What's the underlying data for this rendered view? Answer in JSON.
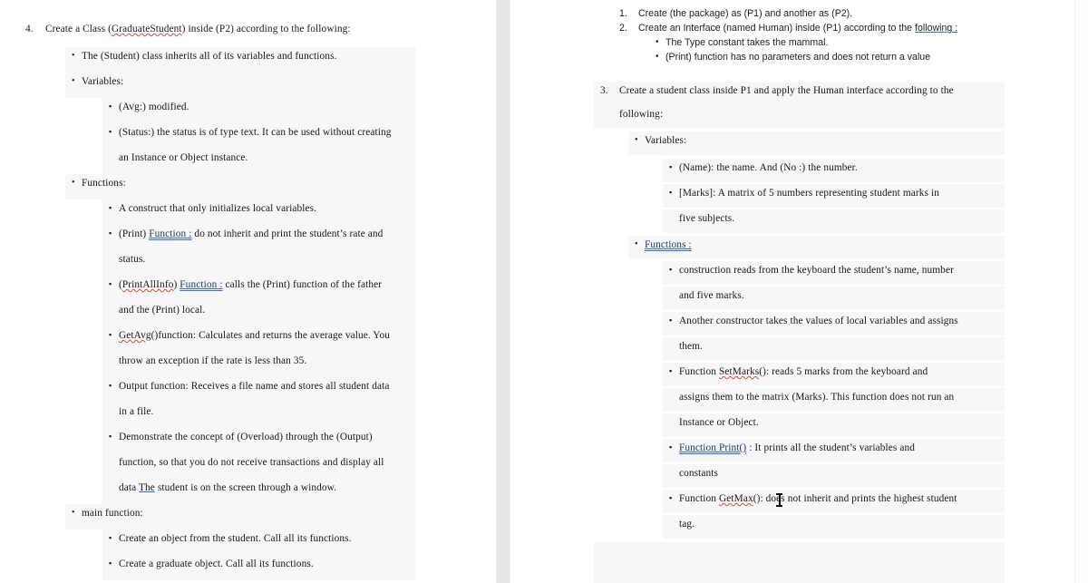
{
  "document": {
    "view": "two-page-side-by-side",
    "cursor": {
      "type": "text-ibeam",
      "over_text": "GetMax()"
    }
  },
  "left_page": {
    "items": [
      {
        "id": "l1",
        "level": "number",
        "marker": "4.",
        "text": "Create a Class (GraduateStudent) inside (P2) according to the following:",
        "band": false
      },
      {
        "id": "l2",
        "level": "disc",
        "marker": "•",
        "text": "The (Student) class inherits all of its variables and functions.",
        "band": true
      },
      {
        "id": "l3",
        "level": "disc",
        "marker": "•",
        "text": "Variables:",
        "band": true
      },
      {
        "id": "l4",
        "level": "square",
        "marker": "▪",
        "text": "(Avg:) modified.",
        "band": true
      },
      {
        "id": "l5",
        "level": "square",
        "marker": "▪",
        "text": "(Status:) the status is of type text. It can be used without creating",
        "band": true
      },
      {
        "id": "l6",
        "level": "cont2",
        "marker": "",
        "text": "an Instance or Object instance.",
        "band": true
      },
      {
        "id": "l7",
        "level": "disc",
        "marker": "•",
        "text": "Functions:",
        "band": true
      },
      {
        "id": "l8",
        "level": "square",
        "marker": "▪",
        "text": "A construct that only initializes local variables.",
        "band": true
      },
      {
        "id": "l9",
        "level": "square",
        "marker": "▪",
        "text": "(Print) Function : do not inherit and print the student’s rate and",
        "band": true
      },
      {
        "id": "l10",
        "level": "cont2",
        "marker": "",
        "text": "status.",
        "band": true
      },
      {
        "id": "l11",
        "level": "square",
        "marker": "▪",
        "text": "(PrintAllInfo) Function : calls the (Print) function of the father",
        "band": true
      },
      {
        "id": "l12",
        "level": "cont2",
        "marker": "",
        "text": "and the (Print) local.",
        "band": true
      },
      {
        "id": "l13",
        "level": "square",
        "marker": "▪",
        "text": "GetAvg()function: Calculates and returns the average value. You",
        "band": true
      },
      {
        "id": "l14",
        "level": "cont2",
        "marker": "",
        "text": "throw an exception if the rate is less than 35.",
        "band": true
      },
      {
        "id": "l15",
        "level": "square",
        "marker": "▪",
        "text": "Output function: Receives a file name and stores all student data",
        "band": true
      },
      {
        "id": "l16",
        "level": "cont2",
        "marker": "",
        "text": "in a file.",
        "band": true
      },
      {
        "id": "l17",
        "level": "square",
        "marker": "▪",
        "text": "Demonstrate the concept of (Overload) through the (Output)",
        "band": true
      },
      {
        "id": "l18",
        "level": "cont2",
        "marker": "",
        "text": "function, so that you do not receive transactions and display all",
        "band": true
      },
      {
        "id": "l19",
        "level": "cont2",
        "marker": "",
        "text": "data The student is on the screen through a window.",
        "band": true
      },
      {
        "id": "l20",
        "level": "disc",
        "marker": "•",
        "text": "main function:",
        "band": true
      },
      {
        "id": "l21",
        "level": "square",
        "marker": "▪",
        "text": "Create an object from the student. Call all its functions.",
        "band": true
      },
      {
        "id": "l22",
        "level": "square",
        "marker": "▪",
        "text": "Create a graduate object. Call all its functions.",
        "band": true
      }
    ]
  },
  "right_page": {
    "items": [
      {
        "id": "r1",
        "level": "number",
        "marker": "1.",
        "text": "Create (the package) as (P1) and another as (P2).",
        "band": false,
        "font": "sans"
      },
      {
        "id": "r2",
        "level": "number",
        "marker": "2.",
        "text": "Create an Interface (named Human) inside (P1) according to the following :",
        "band": false,
        "font": "sans"
      },
      {
        "id": "r3",
        "level": "disc",
        "marker": "•",
        "text": "The Type constant takes the mammal.",
        "band": false,
        "font": "sans"
      },
      {
        "id": "r4",
        "level": "disc",
        "marker": "•",
        "text": "(Print) function has no parameters and does not return a value",
        "band": false,
        "font": "sans"
      },
      {
        "id": "r5",
        "level": "number",
        "marker": "3.",
        "text": "Create a student class inside P1 and apply the Human interface according to the",
        "band": true,
        "font": "serif"
      },
      {
        "id": "r6",
        "level": "cont0",
        "marker": "",
        "text": "following:",
        "band": true,
        "font": "serif"
      },
      {
        "id": "r7",
        "level": "disc",
        "marker": "•",
        "text": "Variables:",
        "band": true,
        "font": "serif"
      },
      {
        "id": "r8",
        "level": "square",
        "marker": "▪",
        "text": "(Name): the name. And (No :) the number.",
        "band": true,
        "font": "serif"
      },
      {
        "id": "r9",
        "level": "square",
        "marker": "▪",
        "text": "[Marks]: A matrix of 5 numbers representing student marks in",
        "band": true,
        "font": "serif"
      },
      {
        "id": "r10",
        "level": "cont2",
        "marker": "",
        "text": "five subjects.",
        "band": true,
        "font": "serif"
      },
      {
        "id": "r11",
        "level": "disc",
        "marker": "•",
        "text": "Functions :",
        "band": true,
        "font": "serif"
      },
      {
        "id": "r12",
        "level": "square",
        "marker": "▪",
        "text": "construction reads from the keyboard the student’s name, number",
        "band": true,
        "font": "serif"
      },
      {
        "id": "r13",
        "level": "cont2",
        "marker": "",
        "text": "and five marks.",
        "band": true,
        "font": "serif"
      },
      {
        "id": "r14",
        "level": "square",
        "marker": "▪",
        "text": "Another constructor takes the values of local variables and assigns",
        "band": true,
        "font": "serif"
      },
      {
        "id": "r15",
        "level": "cont2",
        "marker": "",
        "text": "them.",
        "band": true,
        "font": "serif"
      },
      {
        "id": "r16",
        "level": "square",
        "marker": "▪",
        "text": "Function SetMarks(): reads 5 marks from the keyboard and",
        "band": true,
        "font": "serif"
      },
      {
        "id": "r17",
        "level": "cont2",
        "marker": "",
        "text": "assigns them to the matrix (Marks). This function does not run an",
        "band": true,
        "font": "serif"
      },
      {
        "id": "r18",
        "level": "cont2",
        "marker": "",
        "text": "Instance or Object.",
        "band": true,
        "font": "serif"
      },
      {
        "id": "r19",
        "level": "square",
        "marker": "▪",
        "text": "Function  Print() : It prints all the student’s variables and",
        "band": true,
        "font": "serif"
      },
      {
        "id": "r20",
        "level": "cont2",
        "marker": "",
        "text": "constants",
        "band": true,
        "font": "serif"
      },
      {
        "id": "r21",
        "level": "square",
        "marker": "▪",
        "text": "Function GetMax(): does not inherit and prints the highest student",
        "band": true,
        "font": "serif"
      },
      {
        "id": "r22",
        "level": "cont2",
        "marker": "",
        "text": "tag.",
        "band": true,
        "font": "serif"
      }
    ]
  },
  "colors": {
    "page": "#ffffff",
    "gutter": "#e6e6e6",
    "band": "#f7f7f7",
    "text": "#171717",
    "spell_underline": "#d64a3b",
    "grammar_underline": "#3f6fb5",
    "grammar_text": "#1f3864"
  }
}
